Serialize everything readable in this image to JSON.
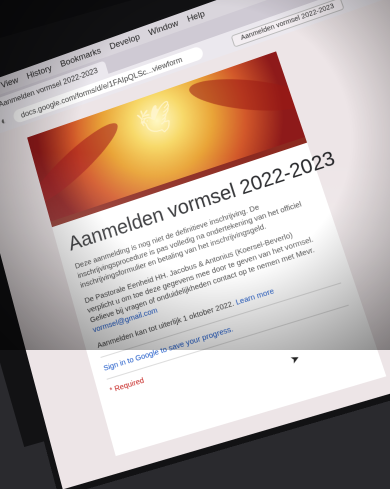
{
  "menubar": {
    "items": [
      "View",
      "History",
      "Bookmarks",
      "Develop",
      "Window",
      "Help"
    ]
  },
  "tabs": [
    {
      "label": "Aanmelden vormsel 2022-2023",
      "active": true
    }
  ],
  "address_bar": {
    "url": "docs.google.com/forms/d/e/1FAIpQLSc...viewform",
    "bookmark_tab": "Aanmelden vormsel 2022-2023"
  },
  "form": {
    "title": "Aanmelden vormsel 2022-2023",
    "description_1": "Deze aanmelding is nog niet de definitieve inschrijving. De inschrijvingsprocedure is pas volledig na ondertekening van het officiel inschrijvingsformulier en betaling van het inschrijvingsgeld.",
    "description_2": "De Pastorale Eenheid HH. Jacobus & Antonius (Koersel-Beverlo) verplicht u om toe deze gegevens mee door te geven van het vormsel. Gelieve bij vragen of onduidelijkheden contact op te nemen met Mevr.",
    "contact_link": "vormsel@gmail.com",
    "deadline": "Aanmelden kan tot uiterlijk 1 oktober 2022.",
    "learn_more": "Learn more",
    "signin": "Sign in to Google to save your progress.",
    "required": "* Required"
  },
  "colors": {
    "header_accent": "#8c2a20",
    "link": "#1a57c8",
    "page_bg": "#ede5e7"
  }
}
